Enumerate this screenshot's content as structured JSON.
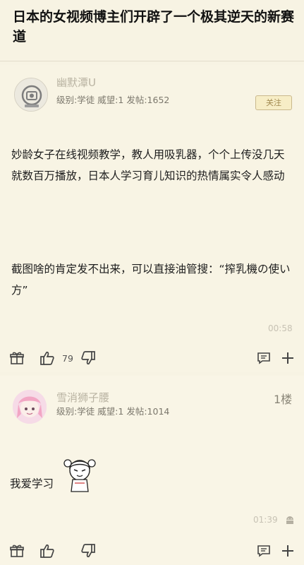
{
  "thread": {
    "title": "日本的女视频博主们开辟了一个极其逆天的新赛道"
  },
  "posts": [
    {
      "username": "幽默潭U",
      "meta": "级别:学徒 威望:1 发帖:1652",
      "follow_label": "关注",
      "paragraphs": [
        "妙龄女子在线视频教学，教人用吸乳器，个个上传没几天就数百万播放，日本人学习育儿知识的热情属实令人感动",
        "截图啥的肯定发不出来，可以直接油管搜：“搾乳機の使い方”"
      ],
      "time": "00:58",
      "like_count": "79",
      "icons": [
        "gift-icon",
        "thumb-up-icon",
        "thumb-down-icon",
        "comment-icon",
        "plus-icon"
      ]
    },
    {
      "username": "雪消狮子腰",
      "meta": "级别:学徒 威望:1 发帖:1014",
      "floor": "1楼",
      "paragraphs": [
        "我爱学习"
      ],
      "time": "01:39",
      "icons": [
        "gift-icon",
        "thumb-up-icon",
        "thumb-down-icon",
        "comment-icon",
        "plus-icon",
        "android-icon"
      ]
    }
  ],
  "colors": {
    "background": "#f7f3e3",
    "username": "#b9b3a2",
    "follow_border": "#c9b88c"
  }
}
